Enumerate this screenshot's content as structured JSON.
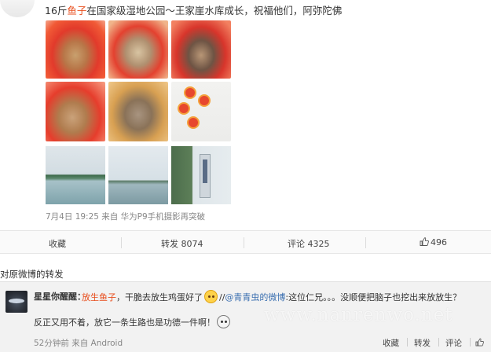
{
  "post": {
    "text_prefix": "16斤",
    "text_highlight": "鱼子",
    "text_suffix": "在国家级湿地公园～王家崖水库成长，祝福他们，阿弥陀佛",
    "meta": "7月4日 19:25 来自 华为P9手机摄影再突破"
  },
  "actions": {
    "favorite": "收藏",
    "repost": "转发 8074",
    "comment": "评论 4325",
    "like": "496"
  },
  "forward_header": "对原微博的转发",
  "comment": {
    "username": "星星你醒醒",
    "colon": "：",
    "highlight": "放生鱼子",
    "text_a": "，干脆去放生鸡蛋好了",
    "mention_sep": "//",
    "mention": "@青青虫的微博",
    "text_b": ":这位仁兄。。。没顺便把脑子也挖出来放放生？",
    "line2": "反正又用不着，放它一条生路也是功德一件啊！",
    "time": "52分钟前 来自 Android",
    "favorite": "收藏",
    "repost": "转发",
    "reply": "评论"
  },
  "watermark": "www.nanrenwo.net",
  "colors": {
    "highlight": "#e84d1c",
    "link": "#3a6fb0",
    "muted": "#888888"
  }
}
